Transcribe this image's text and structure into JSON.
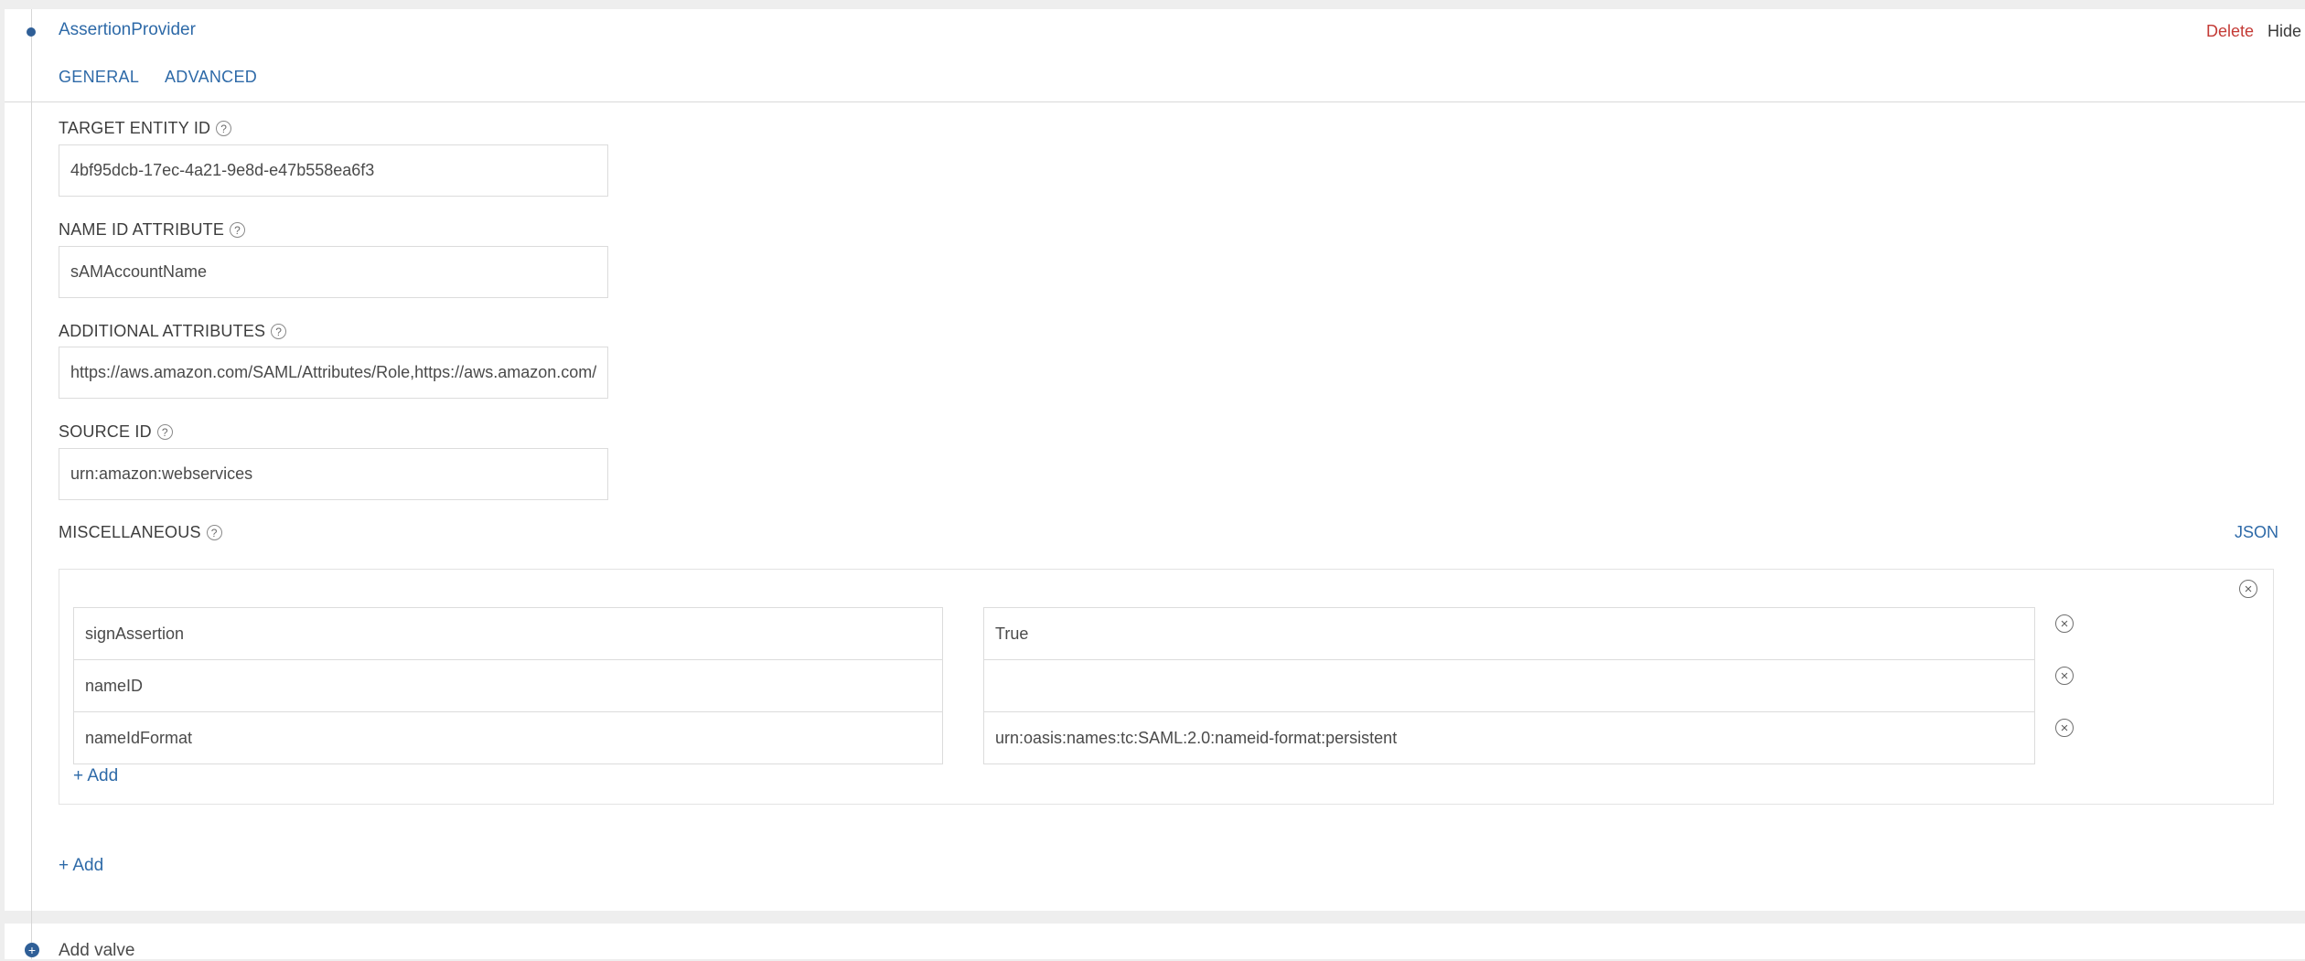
{
  "provider": {
    "title": "AssertionProvider",
    "delete_label": "Delete",
    "hide_label": "Hide"
  },
  "tabs": [
    {
      "label": "GENERAL"
    },
    {
      "label": "ADVANCED"
    }
  ],
  "fields": {
    "target_entity_id": {
      "label": "TARGET ENTITY ID",
      "value": "4bf95dcb-17ec-4a21-9e8d-e47b558ea6f3"
    },
    "name_id_attribute": {
      "label": "NAME ID ATTRIBUTE",
      "value": "sAMAccountName"
    },
    "additional_attributes": {
      "label": "ADDITIONAL ATTRIBUTES",
      "value": "https://aws.amazon.com/SAML/Attributes/Role,https://aws.amazon.com/SAML/Attributes/RoleSessionName"
    },
    "source_id": {
      "label": "SOURCE ID",
      "value": "urn:amazon:webservices"
    }
  },
  "help_glyph": "?",
  "miscellaneous": {
    "label": "MISCELLANEOUS",
    "json_label": "JSON",
    "rows": [
      {
        "key": "signAssertion",
        "value": "True"
      },
      {
        "key": "nameID",
        "value": ""
      },
      {
        "key": "nameIdFormat",
        "value": "urn:oasis:names:tc:SAML:2.0:nameid-format:persistent"
      }
    ],
    "add_label": "+ Add"
  },
  "bottom_add_label": "+ Add",
  "add_valve_label": "Add valve",
  "icons": {
    "remove": "circle-x-icon",
    "help": "question-circle-icon",
    "add_valve": "plus-circle-icon",
    "timeline_dot": "timeline-dot-icon"
  },
  "colors": {
    "accent": "#2e6aa8",
    "danger": "#c43b36",
    "dot": "#2f5f97"
  }
}
